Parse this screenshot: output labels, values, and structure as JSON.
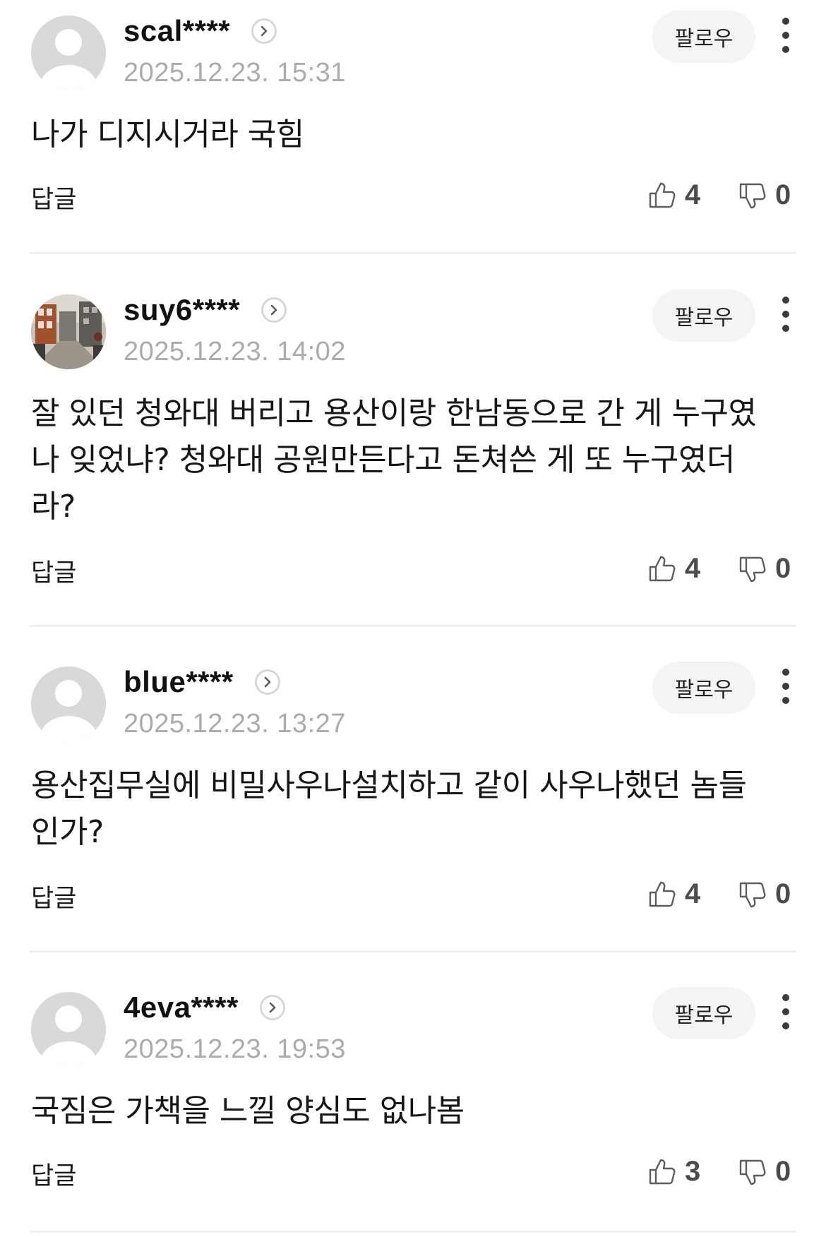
{
  "comments": [
    {
      "username": "scal****",
      "timestamp": "2025.12.23. 15:31",
      "follow_label": "팔로우",
      "text": "나가 디지시거라 국힘",
      "reply_label": "답글",
      "likes": "4",
      "dislikes": "0",
      "avatar": "default-avatar"
    },
    {
      "username": "suy6****",
      "timestamp": "2025.12.23. 14:02",
      "follow_label": "팔로우",
      "text": "잘 있던 청와대 버리고 용산이랑 한남동으로 간 게 누구였나 잊었냐? 청와대 공원만든다고 돈쳐쓴 게 또 누구였더라?",
      "reply_label": "답글",
      "likes": "4",
      "dislikes": "0",
      "avatar": "photo-avatar-street"
    },
    {
      "username": "blue****",
      "timestamp": "2025.12.23. 13:27",
      "follow_label": "팔로우",
      "text": "용산집무실에 비밀사우나설치하고 같이 사우나했던 놈들인가?",
      "reply_label": "답글",
      "likes": "4",
      "dislikes": "0",
      "avatar": "default-avatar"
    },
    {
      "username": "4eva****",
      "timestamp": "2025.12.23. 19:53",
      "follow_label": "팔로우",
      "text": "국짐은 가책을 느낄 양심도 없나봄",
      "reply_label": "답글",
      "likes": "3",
      "dislikes": "0",
      "avatar": "default-avatar"
    }
  ],
  "icons": {
    "profile": "chevron-right-icon",
    "more": "more-vertical-icon",
    "like": "thumbs-up-icon",
    "dislike": "thumbs-down-icon"
  },
  "colors": {
    "timestamp": "#a9abaf",
    "follow_bg": "#f3f4f6",
    "divider": "#eeeff1",
    "vote_count": "#4b4c4f"
  }
}
